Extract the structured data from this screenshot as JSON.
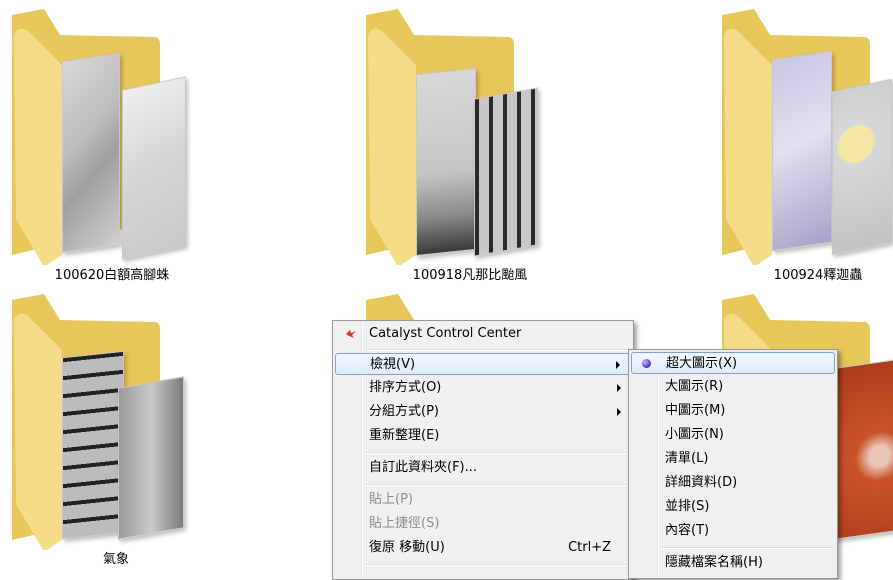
{
  "folders": [
    {
      "label": "100620白額高腳蛛",
      "photo": "spider"
    },
    {
      "label": "100918凡那比颱風",
      "photo": "typhoon"
    },
    {
      "label": "100924釋迦蟲",
      "photo": "insect"
    },
    {
      "label": "氣象",
      "photo": "weather"
    },
    {
      "label": "",
      "photo": "none"
    },
    {
      "label": "",
      "photo": "caterpillar"
    }
  ],
  "context_menu": {
    "items": [
      {
        "label": "Catalyst Control Center",
        "icon": "catalyst-icon"
      },
      {
        "label": "檢視(V)",
        "submenu": true
      },
      {
        "label": "排序方式(O)",
        "submenu": true
      },
      {
        "label": "分組方式(P)",
        "submenu": true
      },
      {
        "label": "重新整理(E)"
      },
      {
        "label": "自訂此資料夾(F)..."
      },
      {
        "label": "貼上(P)",
        "disabled": true
      },
      {
        "label": "貼上捷徑(S)",
        "disabled": true
      },
      {
        "label": "復原 移動(U)",
        "shortcut": "Ctrl+Z"
      }
    ]
  },
  "view_submenu": {
    "items": [
      {
        "label": "超大圖示(X)",
        "selected": true
      },
      {
        "label": "大圖示(R)"
      },
      {
        "label": "中圖示(M)"
      },
      {
        "label": "小圖示(N)"
      },
      {
        "label": "清單(L)"
      },
      {
        "label": "詳細資料(D)"
      },
      {
        "label": "並排(S)"
      },
      {
        "label": "內容(T)"
      },
      {
        "label": "隱藏檔案名稱(H)"
      }
    ]
  },
  "colors": {
    "folder_back": "#e9c95c",
    "folder_front": "#f6df8e",
    "menu_bg": "#f0f0f0",
    "highlight_border": "#7da2ce"
  }
}
